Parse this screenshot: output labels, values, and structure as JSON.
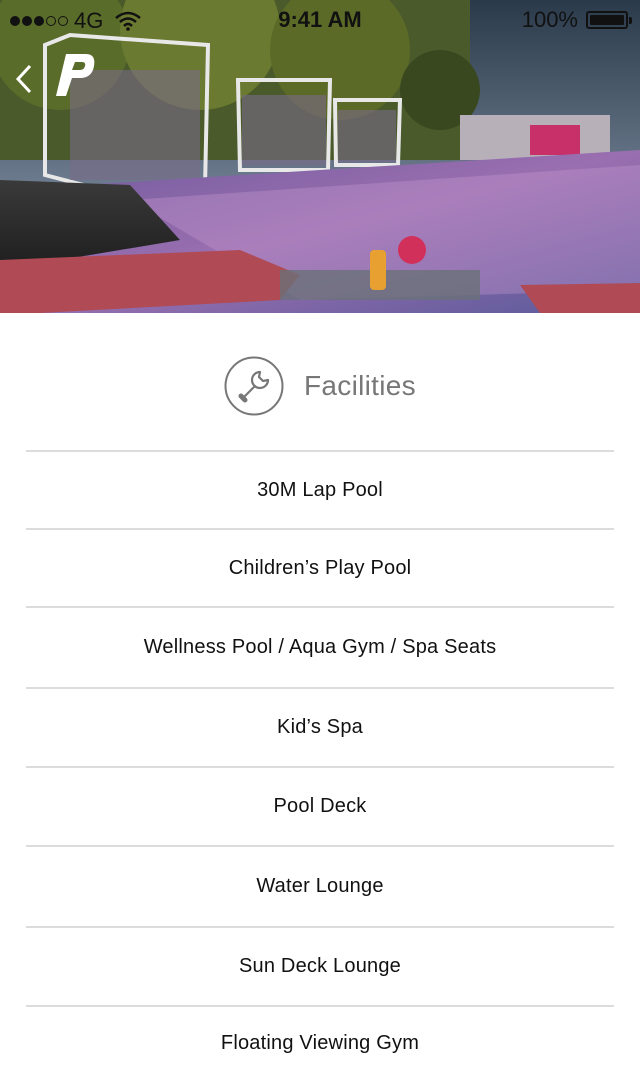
{
  "status_bar": {
    "network": "4G",
    "time": "9:41 AM",
    "battery": "100%",
    "battery_level": 1.0
  },
  "header": {
    "back_icon": "chevron-left-icon",
    "logo_icon": "p-logo-icon"
  },
  "section": {
    "icon": "wrench-icon",
    "title": "Facilities"
  },
  "facilities": [
    {
      "label": "30M Lap Pool"
    },
    {
      "label": "Children’s Play Pool"
    },
    {
      "label": "Wellness Pool / Aqua Gym / Spa Seats"
    },
    {
      "label": "Kid’s Spa"
    },
    {
      "label": "Pool Deck"
    },
    {
      "label": "Water Lounge"
    },
    {
      "label": "Sun Deck Lounge"
    },
    {
      "label": "Floating Viewing Gym"
    }
  ]
}
